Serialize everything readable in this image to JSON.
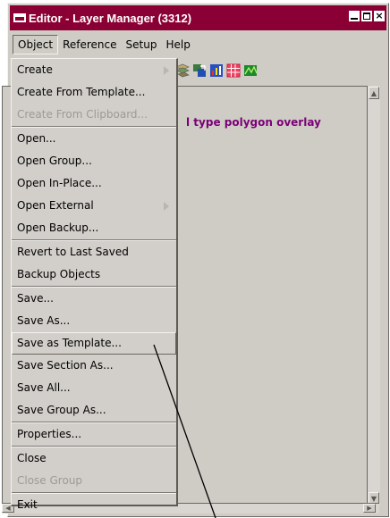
{
  "window": {
    "title": "Editor - Layer Manager (3312)",
    "close_glyph": "×"
  },
  "menubar": {
    "items": [
      "Object",
      "Reference",
      "Setup",
      "Help"
    ]
  },
  "content": {
    "text": "l type polygon overlay"
  },
  "menu": {
    "items": [
      {
        "label": "Create",
        "submenu": true,
        "disabled": false
      },
      {
        "label": "Create From Template...",
        "disabled": false
      },
      {
        "label": "Create From Clipboard...",
        "disabled": true
      },
      {
        "sep": true
      },
      {
        "label": "Open...",
        "disabled": false
      },
      {
        "label": "Open Group...",
        "disabled": false
      },
      {
        "label": "Open In-Place...",
        "disabled": false
      },
      {
        "label": "Open External",
        "submenu": true,
        "disabled": false
      },
      {
        "label": "Open Backup...",
        "disabled": false
      },
      {
        "sep": true
      },
      {
        "label": "Revert to Last Saved",
        "disabled": false
      },
      {
        "label": "Backup Objects",
        "disabled": false
      },
      {
        "sep": true
      },
      {
        "label": "Save...",
        "disabled": false
      },
      {
        "label": "Save As...",
        "disabled": false
      },
      {
        "label": "Save as Template...",
        "disabled": false,
        "hover": true
      },
      {
        "label": "Save Section As...",
        "disabled": false
      },
      {
        "label": "Save All...",
        "disabled": false
      },
      {
        "label": "Save Group As...",
        "disabled": false
      },
      {
        "sep": true
      },
      {
        "label": "Properties...",
        "disabled": false
      },
      {
        "sep": true
      },
      {
        "label": "Close",
        "disabled": false
      },
      {
        "label": "Close Group",
        "disabled": true
      },
      {
        "sep": true
      },
      {
        "label": "Exit",
        "disabled": false
      }
    ]
  },
  "toolbar": {
    "icons": [
      "layer-tool-icon",
      "import-icon",
      "chart-layer-icon",
      "grid-table-icon",
      "map-layer-icon"
    ]
  },
  "colors": {
    "titlebar": "#8b0034",
    "content_text": "#7b0078"
  }
}
